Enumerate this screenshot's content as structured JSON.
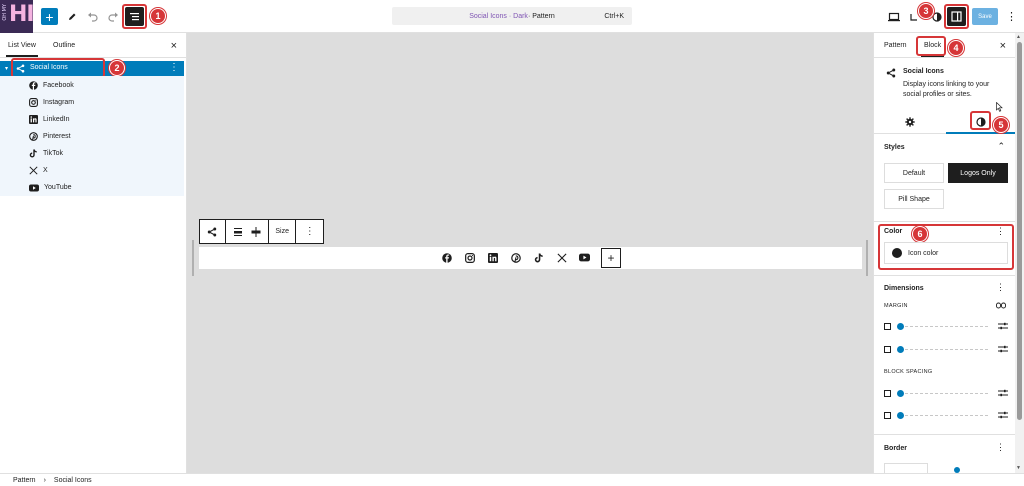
{
  "logo": {
    "small": "OH MY",
    "big": "HI"
  },
  "topbar": {
    "command": {
      "part1": "Social Icons · Dark",
      "part2": " · Pattern",
      "shortcut": "Ctrl+K"
    },
    "save_label": "Save"
  },
  "badges": [
    "1",
    "2",
    "3",
    "4",
    "5",
    "6"
  ],
  "left_panel": {
    "tabs": [
      "List View",
      "Outline"
    ],
    "selected": {
      "label": "Social Icons"
    },
    "children": [
      {
        "label": "Facebook",
        "icon": "facebook-icon"
      },
      {
        "label": "Instagram",
        "icon": "instagram-icon"
      },
      {
        "label": "LinkedIn",
        "icon": "linkedin-icon"
      },
      {
        "label": "Pinterest",
        "icon": "pinterest-icon"
      },
      {
        "label": "TikTok",
        "icon": "tiktok-icon"
      },
      {
        "label": "X",
        "icon": "x-icon"
      },
      {
        "label": "YouTube",
        "icon": "youtube-icon"
      }
    ]
  },
  "block_toolbar": {
    "size_label": "Size"
  },
  "right_panel": {
    "tabs": [
      "Pattern",
      "Block"
    ],
    "block_card": {
      "title": "Social Icons",
      "description": "Display icons linking to your social profiles or sites."
    },
    "styles": {
      "title": "Styles",
      "options": [
        "Default",
        "Logos Only",
        "Pill Shape"
      ],
      "selected": "Logos Only"
    },
    "color": {
      "title": "Color",
      "item": "Icon color"
    },
    "dimensions": {
      "title": "Dimensions",
      "margin_label": "MARGIN",
      "block_spacing_label": "BLOCK SPACING"
    },
    "border": {
      "title": "Border"
    }
  },
  "breadcrumb": [
    "Pattern",
    "Social Icons"
  ],
  "colors": {
    "accent": "#007cba",
    "highlight": "#d63638",
    "canvas": "#dddddd"
  }
}
